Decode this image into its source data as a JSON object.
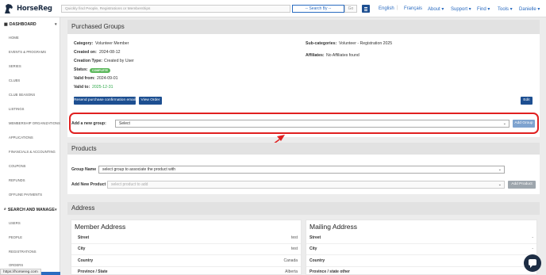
{
  "brand": {
    "name": "HorseReg"
  },
  "search": {
    "placeholder": "Quickly find People, Registrations or Memberships",
    "search_by": "-- Search By --",
    "go_label": "Go"
  },
  "top_nav": {
    "items": [
      {
        "label": "English"
      },
      {
        "label": "Français"
      },
      {
        "label": "About ▾"
      },
      {
        "label": "Support ▾"
      },
      {
        "label": "Find ▾"
      },
      {
        "label": "Tools ▾"
      },
      {
        "label": "Danielle ▾"
      }
    ]
  },
  "sidebar": {
    "dashboard_head": "DASHBOARD",
    "dashboard_items": [
      "HOME",
      "EVENTS & PROGRAMS",
      "SERIES",
      "CLUBS",
      "CLUB SEASONS",
      "LISTINGS",
      "MEMBERSHIP ORGANIZATIONS",
      "APPLICATIONS",
      "FINANCIALS & ACCOUNTING",
      "COUPONS",
      "REFUNDS",
      "OFFLINE PAYMENTS"
    ],
    "search_head": "SEARCH AND MANAGE",
    "search_items": [
      "USERS",
      "PEOPLE",
      "REGISTRATIONS",
      "ORDERS"
    ],
    "status_url": "https://horsereg.com"
  },
  "purchased_groups": {
    "title": "Purchased Groups",
    "category_label": "Category:",
    "category_value": "Volunteer Member",
    "created_on_label": "Created on:",
    "created_on_value": "2024-08-12",
    "creation_type_label": "Creation Type:",
    "creation_type_value": "Created by User",
    "status_label": "Status:",
    "status_value": "COMPLETE",
    "valid_from_label": "Valid from:",
    "valid_from_value": "2024-09-01",
    "valid_to_label": "Valid to:",
    "valid_to_value": "2025-12-31",
    "subcategories_label": "Sub-categories:",
    "subcategories_value": "Volunteer - Registration 2025",
    "affiliates_label": "Affiliates:",
    "affiliates_value": "No Affiliates found",
    "resend_button": "Resend purchase confirmation email",
    "view_order_button": "View Order",
    "edit_button": "Edit",
    "add_group_label": "Add a new group:",
    "add_group_select": "Select",
    "add_group_button": "Add Group"
  },
  "products": {
    "title": "Products",
    "group_name_label": "Group Name",
    "group_name_select": "select group to associate the product with",
    "add_product_label": "Add New Product",
    "add_product_select": "select product to add",
    "add_product_button": "Add Product"
  },
  "address": {
    "title": "Address",
    "member": {
      "title": "Member Address",
      "rows": [
        {
          "k": "Street",
          "v": "test"
        },
        {
          "k": "City",
          "v": "test"
        },
        {
          "k": "Country",
          "v": "Canada"
        },
        {
          "k": "Province / State",
          "v": "Alberta"
        }
      ]
    },
    "mailing": {
      "title": "Mailing Address",
      "rows": [
        {
          "k": "Street",
          "v": "-"
        },
        {
          "k": "City",
          "v": "-"
        },
        {
          "k": "Country",
          "v": "-"
        },
        {
          "k": "Province / state other",
          "v": ""
        }
      ]
    }
  },
  "colors": {
    "accent": "#1d4f91",
    "highlight": "#e02020",
    "success": "#2ea84a"
  },
  "icons": {
    "logo": "horse-head-icon",
    "menu": "hamburger-icon",
    "chat": "chat-icon"
  }
}
